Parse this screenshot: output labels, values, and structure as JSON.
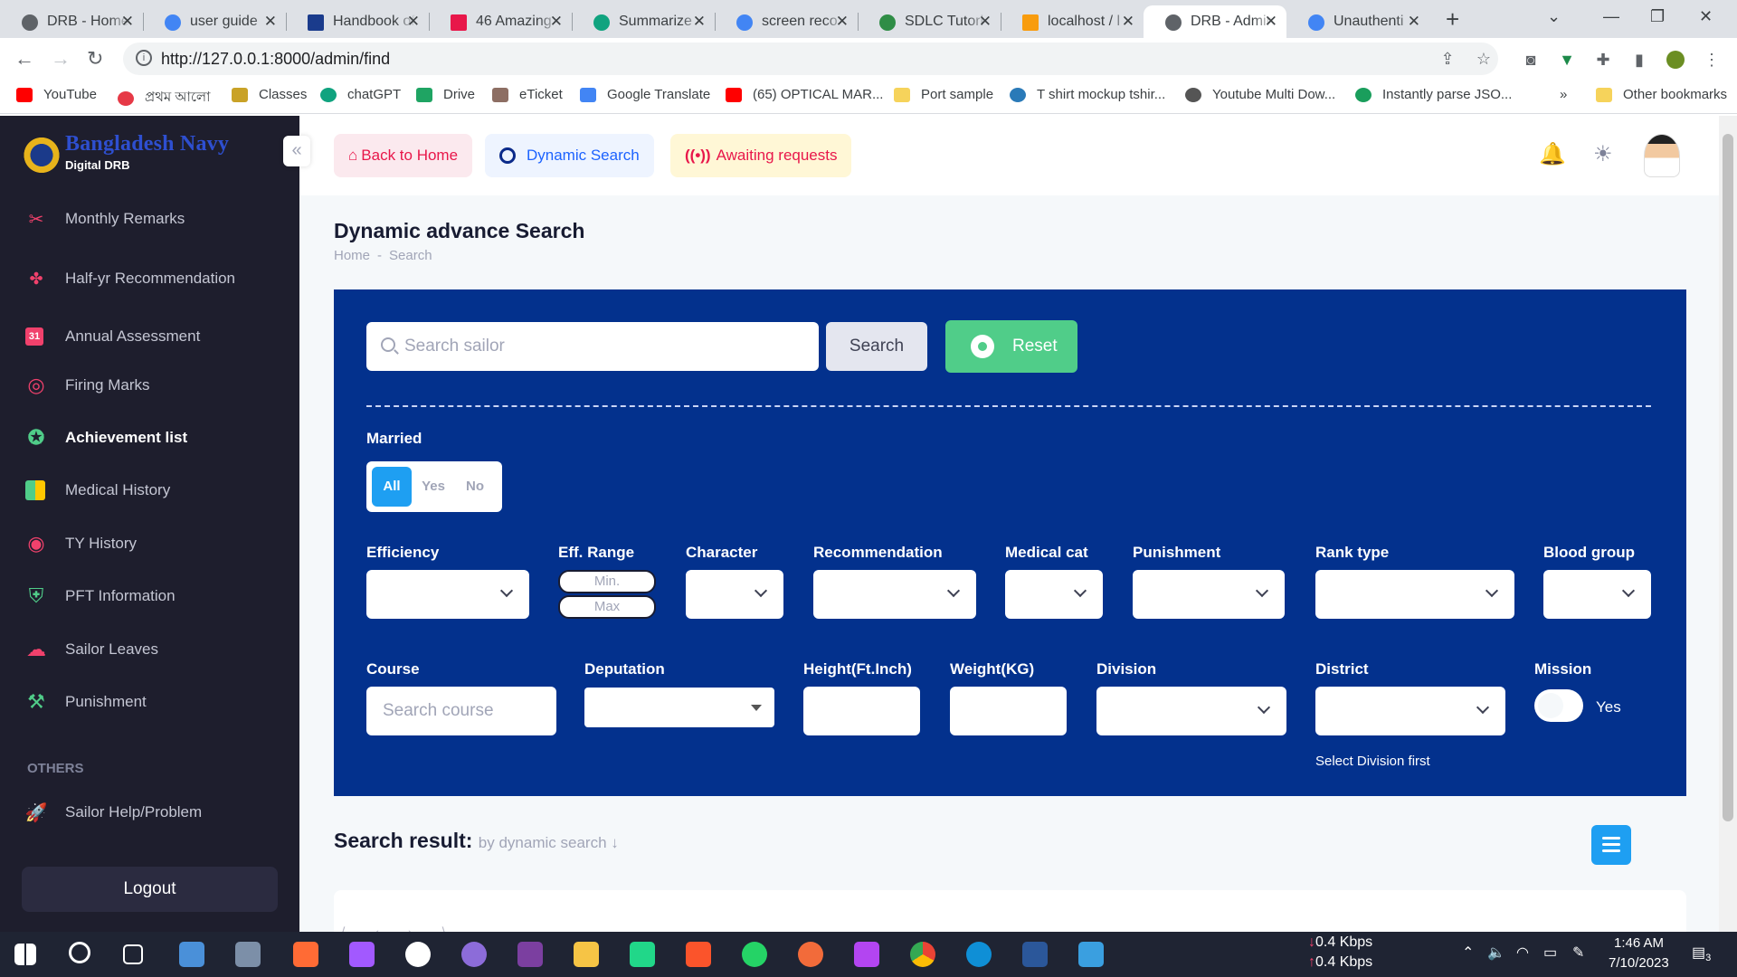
{
  "browser": {
    "tabs": [
      {
        "title": "DRB - Home",
        "color": "#5f6368"
      },
      {
        "title": "user guide",
        "color": "#4285f4"
      },
      {
        "title": "Handbook of",
        "color": "#1a3b8c"
      },
      {
        "title": "46 Amazing",
        "color": "#e8174a"
      },
      {
        "title": "Summarize",
        "color": "#10a37f"
      },
      {
        "title": "screen reco",
        "color": "#4285f4"
      },
      {
        "title": "SDLC Tutori",
        "color": "#2f8d46"
      },
      {
        "title": "localhost / l",
        "color": "#f89c0e"
      },
      {
        "title": "DRB - Admin",
        "color": "#5f6368",
        "active": true
      },
      {
        "title": "Unauthenti",
        "color": "#4285f4"
      }
    ],
    "new_tab": "+",
    "url": "http://127.0.0.1:8000/admin/find",
    "bookmarks": [
      {
        "label": "YouTube",
        "color": "#ff0000"
      },
      {
        "label": "প্রথম আলো",
        "color": "#e63946"
      },
      {
        "label": "Classes",
        "color": "#c9a227"
      },
      {
        "label": "chatGPT",
        "color": "#10a37f"
      },
      {
        "label": "Drive",
        "color": "#1fa463"
      },
      {
        "label": "eTicket",
        "color": "#8d6e63"
      },
      {
        "label": "Google Translate",
        "color": "#4285f4"
      },
      {
        "label": "(65) OPTICAL MAR...",
        "color": "#ff0000"
      },
      {
        "label": "Port sample",
        "color": "#f6d35b"
      },
      {
        "label": "T shirt mockup tshir...",
        "color": "#2a7ab8"
      },
      {
        "label": "Youtube Multi Dow...",
        "color": "#555555"
      },
      {
        "label": "Instantly parse JSO...",
        "color": "#1a9e5c"
      }
    ],
    "more_bookmarks": "»",
    "other_bookmarks": "Other bookmarks"
  },
  "sidebar": {
    "brand": "Bangladesh Navy",
    "brand_sub": "Digital DRB",
    "collapse_icon": "«",
    "items": [
      {
        "label": "Monthly Remarks",
        "icon": "remarks-icon",
        "color": "#f1416c"
      },
      {
        "label": "Half-yr Recommendation",
        "icon": "recommendation-icon",
        "color": "#f1416c"
      },
      {
        "label": "Annual Assessment",
        "icon": "calendar-icon",
        "color": "#f1416c"
      },
      {
        "label": "Firing Marks",
        "icon": "target-icon",
        "color": "#f1416c"
      },
      {
        "label": "Achievement list",
        "icon": "award-icon",
        "color": "#50cd89",
        "active": true
      },
      {
        "label": "Medical History",
        "icon": "medical-icon",
        "color": "#ffc700"
      },
      {
        "label": "TY History",
        "icon": "history-icon",
        "color": "#f1416c"
      },
      {
        "label": "PFT Information",
        "icon": "shield-check-icon",
        "color": "#50cd89"
      },
      {
        "label": "Sailor Leaves",
        "icon": "leaves-icon",
        "color": "#f1416c"
      },
      {
        "label": "Punishment",
        "icon": "punishment-icon",
        "color": "#50cd89"
      }
    ],
    "section_others": "OTHERS",
    "help_item": "Sailor Help/Problem",
    "logout": "Logout"
  },
  "header": {
    "back_home": "Back to Home",
    "dynamic_search": "Dynamic Search",
    "awaiting": "Awaiting requests"
  },
  "page": {
    "title": "Dynamic advance Search",
    "breadcrumb": [
      "Home",
      "-",
      "Search"
    ]
  },
  "search": {
    "placeholder": "Search sailor",
    "search_button": "Search",
    "reset_button": "Reset"
  },
  "filters": {
    "married_label": "Married",
    "married_options": [
      "All",
      "Yes",
      "No"
    ],
    "married_selected": "All",
    "efficiency": "Efficiency",
    "eff_range": "Eff. Range",
    "eff_min": "Min.",
    "eff_max": "Max",
    "character": "Character",
    "recommendation": "Recommendation",
    "medical_cat": "Medical cat",
    "punishment": "Punishment",
    "rank_type": "Rank type",
    "blood_group": "Blood group",
    "course": "Course",
    "course_placeholder": "Search course",
    "deputation": "Deputation",
    "height": "Height(Ft.Inch)",
    "weight": "Weight(KG)",
    "division": "Division",
    "district": "District",
    "district_hint": "Select Division first",
    "mission": "Mission",
    "mission_toggle": "Yes"
  },
  "results": {
    "title": "Search result:",
    "subtitle": "by dynamic search ↓",
    "pager": "⟨ ‹ › ⟩"
  },
  "taskbar": {
    "net_down": "0.4 Kbps",
    "net_up": "0.4 Kbps",
    "time": "1:46 AM",
    "date": "7/10/2023",
    "notifications": "3"
  }
}
